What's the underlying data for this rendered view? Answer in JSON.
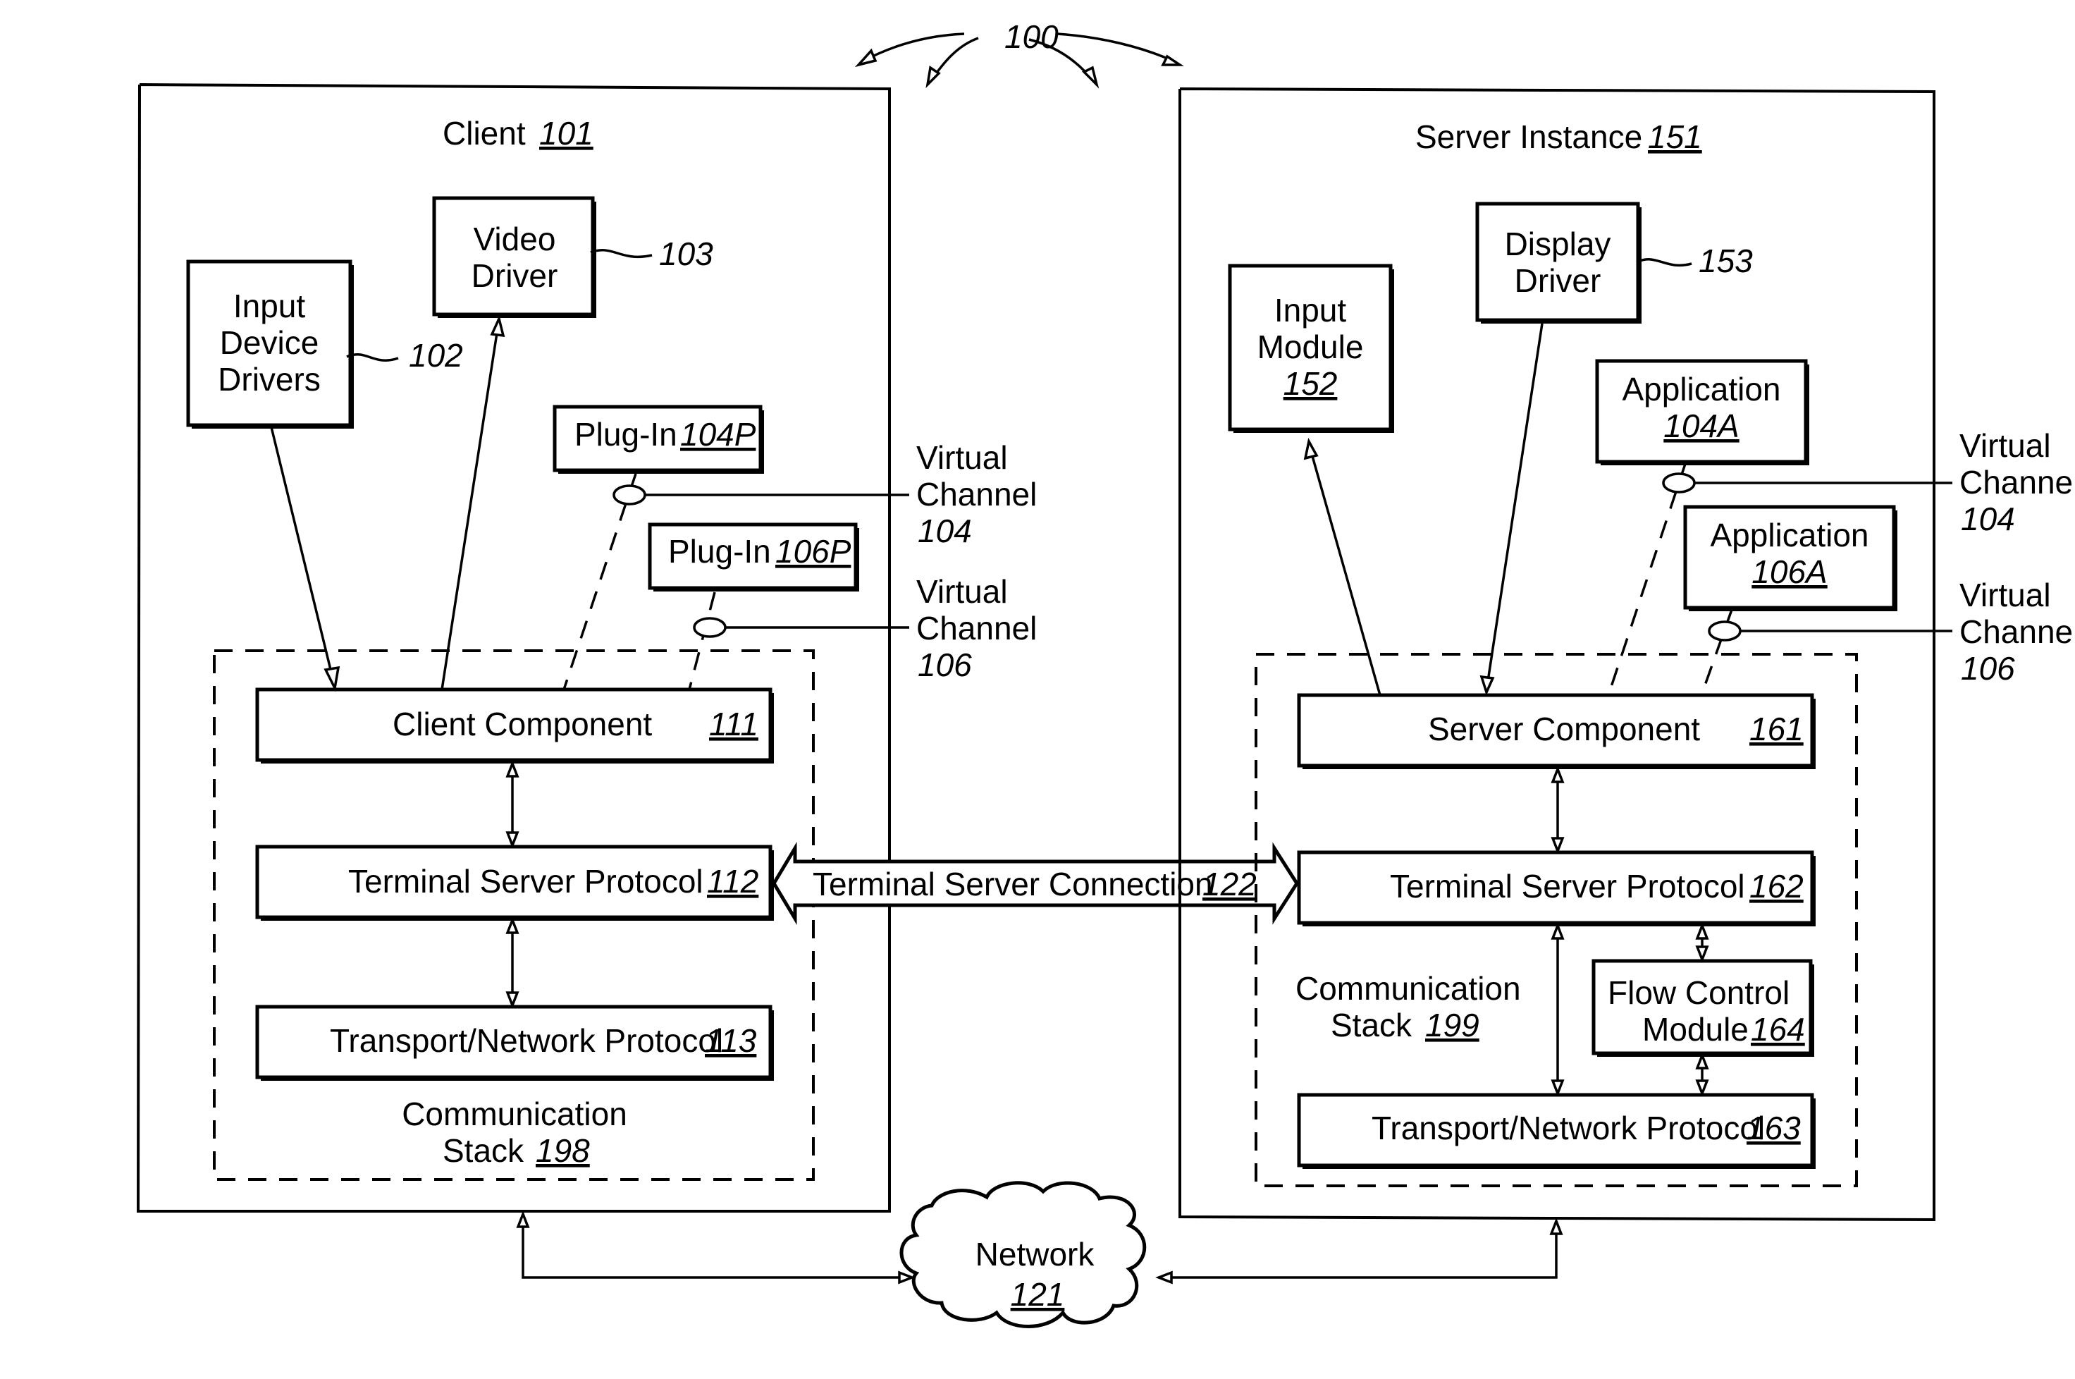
{
  "figure": {
    "ref": "100"
  },
  "client": {
    "title": "Client",
    "ref": "101",
    "input_device_drivers": {
      "lines": [
        "Input",
        "Device",
        "Drivers"
      ],
      "ref": "102"
    },
    "video_driver": {
      "lines": [
        "Video",
        "Driver"
      ],
      "ref": "103"
    },
    "plugin_104": {
      "label": "Plug-In",
      "ref": "104P"
    },
    "plugin_106": {
      "label": "Plug-In",
      "ref": "106P"
    },
    "virtual_channel_104": {
      "lines": [
        "Virtual",
        "Channel"
      ],
      "ref": "104"
    },
    "virtual_channel_106": {
      "lines": [
        "Virtual",
        "Channel"
      ],
      "ref": "106"
    },
    "client_component": {
      "label": "Client Component",
      "ref": "111"
    },
    "terminal_server_protocol": {
      "label": "Terminal Server Protocol",
      "ref": "112"
    },
    "transport_network_protocol": {
      "label": "Transport/Network Protocol",
      "ref": "113"
    },
    "communication_stack": {
      "lines": [
        "Communication",
        "Stack"
      ],
      "ref": "198"
    }
  },
  "server": {
    "title": "Server Instance",
    "ref": "151",
    "input_module": {
      "lines": [
        "Input",
        "Module"
      ],
      "ref": "152"
    },
    "display_driver": {
      "lines": [
        "Display",
        "Driver"
      ],
      "ref": "153"
    },
    "application_104": {
      "label": "Application",
      "ref": "104A"
    },
    "application_106": {
      "label": "Application",
      "ref": "106A"
    },
    "virtual_channel_104": {
      "lines": [
        "Virtual",
        "Channel"
      ],
      "ref": "104"
    },
    "virtual_channel_106": {
      "lines": [
        "Virtual",
        "Channel"
      ],
      "ref": "106"
    },
    "server_component": {
      "label": "Server Component",
      "ref": "161"
    },
    "terminal_server_protocol": {
      "label": "Terminal Server Protocol",
      "ref": "162"
    },
    "transport_network_protocol": {
      "label": "Transport/Network Protocol",
      "ref": "163"
    },
    "flow_control_module": {
      "lines": [
        "Flow Control",
        "Module"
      ],
      "ref": "164"
    },
    "communication_stack": {
      "lines": [
        "Communication",
        "Stack"
      ],
      "ref": "199"
    }
  },
  "connection": {
    "label": "Terminal Server Connection",
    "ref": "122"
  },
  "network": {
    "label": "Network",
    "ref": "121"
  }
}
